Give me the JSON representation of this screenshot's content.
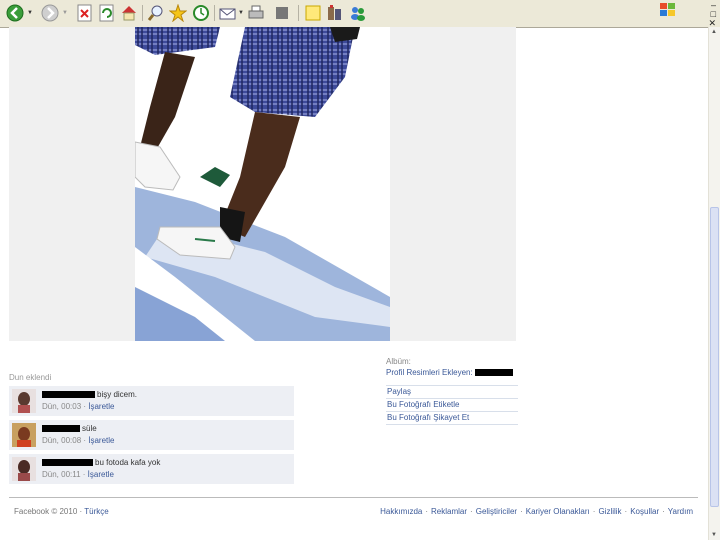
{
  "browser": {
    "toolbar_icons": [
      "back-icon",
      "forward-icon",
      "stop-icon",
      "refresh-icon",
      "home-icon",
      "search-icon",
      "favorites-icon",
      "history-icon",
      "mail-icon",
      "print-icon",
      "edit-icon",
      "discuss-icon",
      "research-icon",
      "messenger-icon"
    ]
  },
  "photo": {
    "alt": ""
  },
  "comments_section": {
    "added_label": "Dun eklendi",
    "comments": [
      {
        "text": "bişy dicem.",
        "time": "Dün, 00:03",
        "report": "İşaretle"
      },
      {
        "text": "süle",
        "time": "Dün, 00:08",
        "report": "İşaretle"
      },
      {
        "text": "bu fotoda kafa yok",
        "time": "Dün, 00:11",
        "report": "İşaretle"
      }
    ],
    "separator": " · "
  },
  "album": {
    "caption": "Albüm:",
    "added_by": "Profil Resimleri Ekleyen:",
    "actions": [
      "Paylaş",
      "Bu Fotoğrafı Etiketle",
      "Bu Fotoğrafı Şikayet Et"
    ]
  },
  "footer": {
    "copyright": "Facebook © 2010 ·",
    "language": "Türkçe",
    "links": [
      "Hakkımızda",
      "Reklamlar",
      "Geliştiriciler",
      "Kariyer Olanakları",
      "Gizlilik",
      "Koşullar",
      "Yardım"
    ]
  },
  "colors": {
    "link": "#3b5998",
    "comment_bg": "#edeff4"
  }
}
